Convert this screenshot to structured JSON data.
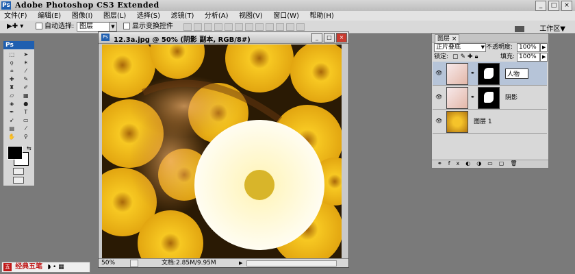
{
  "app": {
    "icon": "Ps",
    "title": "Adobe Photoshop CS3 Extended"
  },
  "window_controls": {
    "minimize": "_",
    "maximize": "□",
    "close": "×"
  },
  "menu": [
    "文件(F)",
    "编辑(E)",
    "图像(I)",
    "图层(L)",
    "选择(S)",
    "滤镜(T)",
    "分析(A)",
    "视图(V)",
    "窗口(W)",
    "帮助(H)"
  ],
  "options_bar": {
    "auto_select_label": "自动选择:",
    "auto_select_value": "图层",
    "show_transform_label": "显示变换控件",
    "workspace_label": "工作区▼"
  },
  "toolbox": {
    "title": "Ps"
  },
  "document": {
    "title": "12.3a.jpg @ 50% (阴影 副本, RGB/8#)",
    "zoom": "50%",
    "doc_info": "文档:2.85M/9.95M"
  },
  "layers_panel": {
    "tab_label": "图层 ×",
    "blend_mode": "正片叠底",
    "opacity_label": "不透明度:",
    "opacity_value": "100%",
    "lock_label": "锁定:",
    "fill_label": "填充:",
    "fill_value": "100%",
    "layers": [
      {
        "name": "人物",
        "selected": true,
        "has_mask": true
      },
      {
        "name": "阴影",
        "selected": false,
        "has_mask": true
      },
      {
        "name": "图层 1",
        "selected": false,
        "has_mask": false
      }
    ]
  },
  "ime": {
    "name": "经典五笔"
  },
  "colors": {
    "accent": "#1f5fb0",
    "flower": "#f2c21b",
    "selected_layer": "#b6c4d8"
  }
}
